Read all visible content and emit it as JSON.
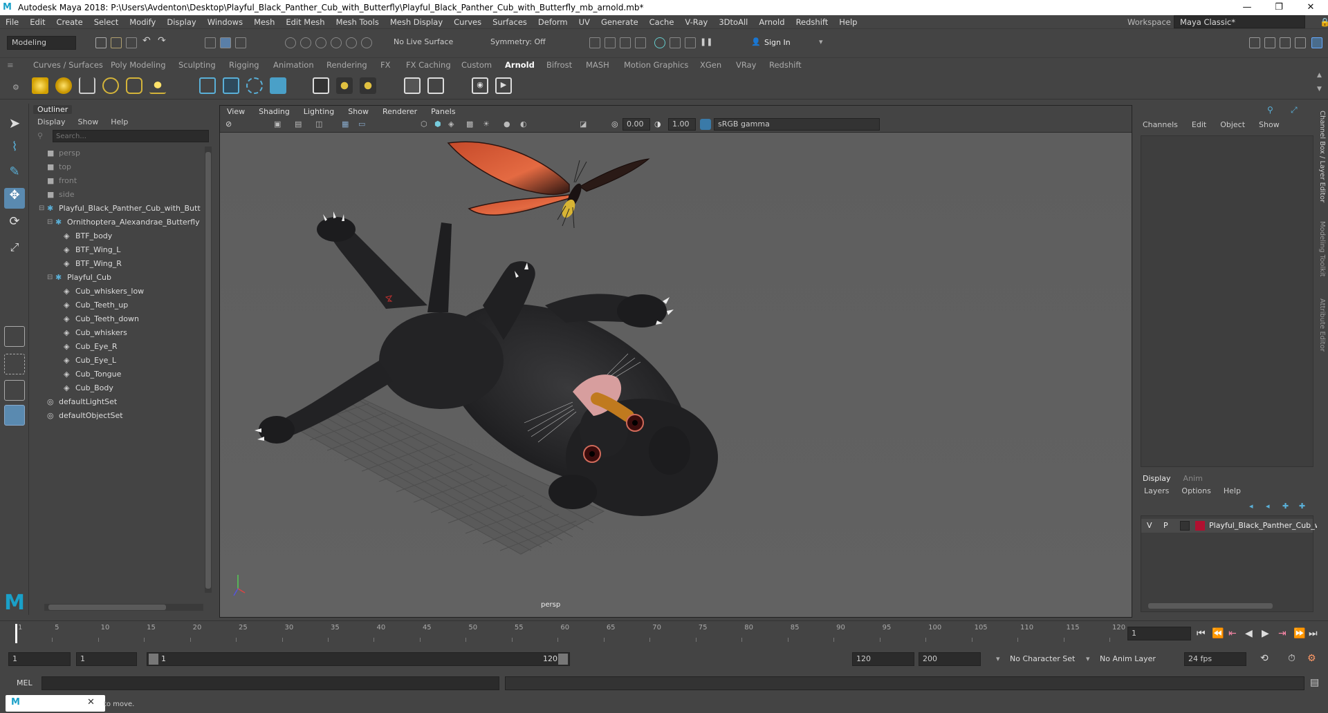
{
  "titlebar": {
    "title": "Autodesk Maya 2018: P:\\Users\\Avdenton\\Desktop\\Playful_Black_Panther_Cub_with_Butterfly\\Playful_Black_Panther_Cub_with_Butterfly_mb_arnold.mb*",
    "minimize": "—",
    "maximize": "❐",
    "close": "✕"
  },
  "menubar": {
    "items": [
      "File",
      "Edit",
      "Create",
      "Select",
      "Modify",
      "Display",
      "Windows",
      "Mesh",
      "Edit Mesh",
      "Mesh Tools",
      "Mesh Display",
      "Curves",
      "Surfaces",
      "Deform",
      "UV",
      "Generate",
      "Cache",
      "V-Ray",
      "3DtoAll",
      "Arnold",
      "Redshift",
      "Help"
    ],
    "workspace_label": "Workspace :",
    "workspace_value": "Maya Classic*"
  },
  "statusline": {
    "mode": "Modeling",
    "live_surface": "No Live Surface",
    "symmetry": "Symmetry: Off",
    "sign_in": "Sign In"
  },
  "shelf": {
    "tabs": [
      "Curves / Surfaces",
      "Poly Modeling",
      "Sculpting",
      "Rigging",
      "Animation",
      "Rendering",
      "FX",
      "FX Caching",
      "Custom",
      "Arnold",
      "Bifrost",
      "MASH",
      "Motion Graphics",
      "XGen",
      "VRay",
      "Redshift"
    ],
    "active_tab": "Arnold"
  },
  "outliner": {
    "title": "Outliner",
    "menu": [
      "Display",
      "Show",
      "Help"
    ],
    "search_placeholder": "Search...",
    "items": [
      {
        "label": "persp",
        "type": "camera",
        "indent": 0
      },
      {
        "label": "top",
        "type": "camera",
        "indent": 0
      },
      {
        "label": "front",
        "type": "camera",
        "indent": 0
      },
      {
        "label": "side",
        "type": "camera",
        "indent": 0
      },
      {
        "label": "Playful_Black_Panther_Cub_with_Butt",
        "type": "group",
        "indent": 0
      },
      {
        "label": "Ornithoptera_Alexandrae_Butterfly",
        "type": "group",
        "indent": 1
      },
      {
        "label": "BTF_body",
        "type": "mesh",
        "indent": 2
      },
      {
        "label": "BTF_Wing_L",
        "type": "mesh",
        "indent": 2
      },
      {
        "label": "BTF_Wing_R",
        "type": "mesh",
        "indent": 2
      },
      {
        "label": "Playful_Cub",
        "type": "group",
        "indent": 1
      },
      {
        "label": "Cub_whiskers_low",
        "type": "mesh",
        "indent": 2
      },
      {
        "label": "Cub_Teeth_up",
        "type": "mesh",
        "indent": 2
      },
      {
        "label": "Cub_Teeth_down",
        "type": "mesh",
        "indent": 2
      },
      {
        "label": "Cub_whiskers",
        "type": "mesh",
        "indent": 2
      },
      {
        "label": "Cub_Eye_R",
        "type": "mesh",
        "indent": 2
      },
      {
        "label": "Cub_Eye_L",
        "type": "mesh",
        "indent": 2
      },
      {
        "label": "Cub_Tongue",
        "type": "mesh",
        "indent": 2
      },
      {
        "label": "Cub_Body",
        "type": "mesh",
        "indent": 2
      },
      {
        "label": "defaultLightSet",
        "type": "set",
        "indent": 0
      },
      {
        "label": "defaultObjectSet",
        "type": "set",
        "indent": 0
      }
    ]
  },
  "viewport": {
    "menu": [
      "View",
      "Shading",
      "Lighting",
      "Show",
      "Renderer",
      "Panels"
    ],
    "exposure": "0.00",
    "gamma": "1.00",
    "color_space": "sRGB gamma",
    "camera_label": "persp"
  },
  "channelbox": {
    "menu": [
      "Channels",
      "Edit",
      "Object",
      "Show"
    ]
  },
  "layer_editor": {
    "tabs": [
      "Display",
      "Anim"
    ],
    "menu": [
      "Layers",
      "Options",
      "Help"
    ],
    "layer": {
      "v": "V",
      "p": "P",
      "name": "Playful_Black_Panther_Cub_wi",
      "color": "#b01030"
    }
  },
  "right_strip": [
    "Channel Box / Layer Editor",
    "Modeling Toolkit",
    "Attribute Editor"
  ],
  "timeslider": {
    "ticks": [
      "1",
      "5",
      "10",
      "15",
      "20",
      "25",
      "30",
      "35",
      "40",
      "45",
      "50",
      "55",
      "60",
      "65",
      "70",
      "75",
      "80",
      "85",
      "90",
      "95",
      "100",
      "105",
      "110",
      "115",
      "120"
    ],
    "current_frame": "1"
  },
  "range": {
    "start": "1",
    "playback_start": "1",
    "slider_start": "1",
    "slider_end": "120",
    "playback_end": "120",
    "end": "200",
    "character_set": "No Character Set",
    "anim_layer": "No Anim Layer",
    "fps": "24 fps"
  },
  "cmdline": {
    "label": "MEL"
  },
  "helpline": {
    "text": "to move."
  }
}
